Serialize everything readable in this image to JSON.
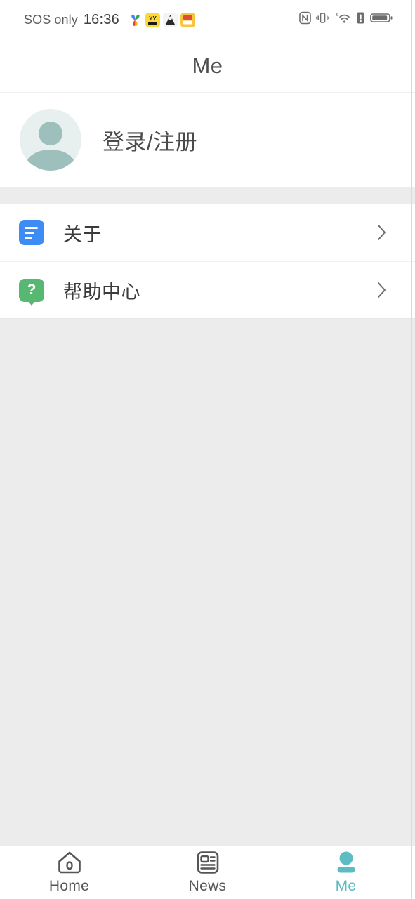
{
  "status_bar": {
    "carrier": "SOS only",
    "clock": "16:36",
    "notification_icons": [
      {
        "name": "pinwheel-app-icon"
      },
      {
        "name": "yy-app-icon",
        "label": "YY"
      },
      {
        "name": "penguin-app-icon"
      },
      {
        "name": "orange-app-icon"
      }
    ],
    "system_icons": [
      {
        "name": "nfc-icon"
      },
      {
        "name": "vibrate-icon"
      },
      {
        "name": "wifi-icon",
        "label": "6"
      },
      {
        "name": "sim-alert-icon"
      },
      {
        "name": "battery-icon"
      }
    ]
  },
  "header": {
    "title": "Me"
  },
  "profile": {
    "login_label": "登录/注册",
    "avatar_bg": "#e7f0ee",
    "avatar_fg": "#9dc0bd"
  },
  "menu": {
    "items": [
      {
        "label": "关于",
        "icon": "about-document-icon",
        "icon_color": "#3d8bf5",
        "chevron": "chevron-right-icon"
      },
      {
        "label": "帮助中心",
        "icon": "help-question-icon",
        "icon_color": "#56b871",
        "icon_glyph": "?",
        "chevron": "chevron-right-icon"
      }
    ]
  },
  "tabbar": {
    "active_color": "#5bbcc4",
    "inactive_color": "#555555",
    "tabs": [
      {
        "label": "Home",
        "icon": "home-icon",
        "active": false
      },
      {
        "label": "News",
        "icon": "news-icon",
        "active": false
      },
      {
        "label": "Me",
        "icon": "person-icon",
        "active": true
      }
    ]
  },
  "colors": {
    "page_background": "#ececec",
    "card_background": "#ffffff",
    "accent_teal": "#5bbcc4",
    "blue": "#3d8bf5",
    "green": "#56b871"
  }
}
